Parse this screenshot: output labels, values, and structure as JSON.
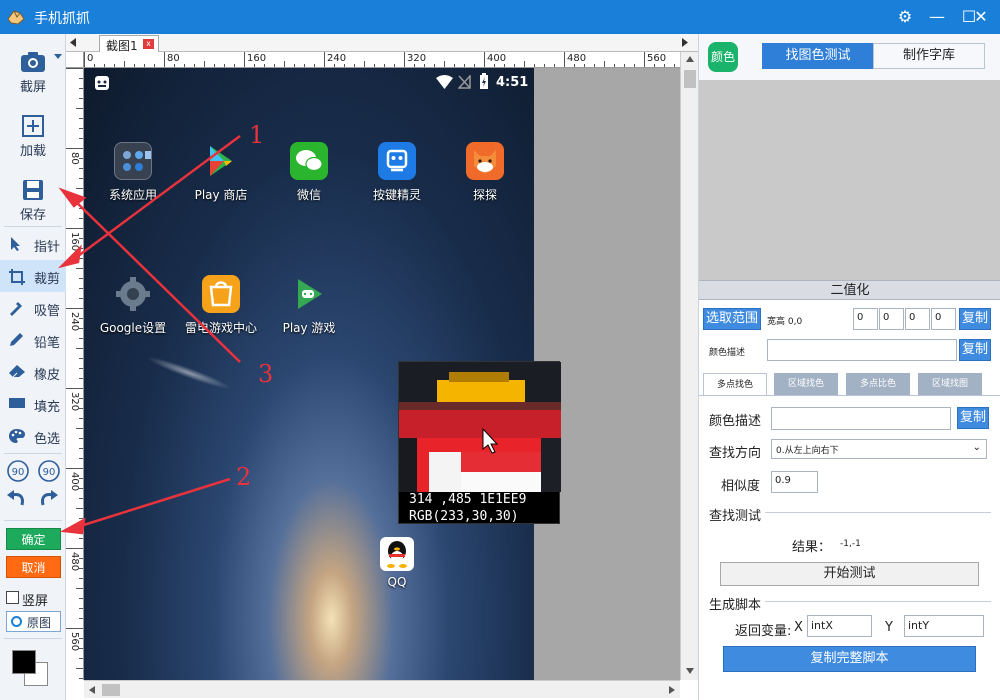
{
  "window": {
    "title": "手机抓抓",
    "buttons": {
      "settings": "⚙",
      "minimize": "—",
      "maximize": "☐",
      "close": "✕"
    }
  },
  "toolbar": {
    "screenshot": "截屏",
    "load": "加载",
    "save": "保存",
    "pointer": "指针",
    "crop": "裁剪",
    "picker": "吸管",
    "pencil": "铅笔",
    "eraser": "橡皮",
    "fill": "填充",
    "select_color": "色选",
    "rotate_left_label": "90",
    "rotate_right_label": "90",
    "confirm": "确定",
    "cancel": "取消",
    "portrait": "竖屏",
    "original": "原图"
  },
  "document_tab": {
    "label": "截图1",
    "close": "x"
  },
  "ruler": {
    "h_ticks": [
      "0",
      "80",
      "160",
      "240",
      "320",
      "400",
      "480",
      "560"
    ],
    "v_ticks": [
      "80",
      "160",
      "240",
      "320",
      "400",
      "480",
      "560"
    ]
  },
  "phone": {
    "status_time": "4:51",
    "apps": [
      {
        "label": "系统应用",
        "icon": "folder-icon"
      },
      {
        "label": "Play 商店",
        "icon": "play-store-icon"
      },
      {
        "label": "微信",
        "icon": "wechat-icon"
      },
      {
        "label": "按键精灵",
        "icon": "robot-icon"
      },
      {
        "label": "探探",
        "icon": "fox-icon"
      },
      {
        "label": "Google设置",
        "icon": "google-gear-icon"
      },
      {
        "label": "雷电游戏中心",
        "icon": "game-center-icon"
      },
      {
        "label": "Play 游戏",
        "icon": "play-games-icon"
      },
      {
        "label": "QQ",
        "icon": "qq-icon"
      }
    ]
  },
  "magnifier": {
    "coords_hex": "314 ,485  1E1EE9",
    "rgb": "RGB(233,30,30)"
  },
  "annotations": {
    "n1": "1",
    "n2": "2",
    "n3": "3"
  },
  "panel": {
    "color_badge": "颜色",
    "tab_find": "找图色测试",
    "tab_lib": "制作字库",
    "binarize": "二值化",
    "select_range": "选取范围",
    "size_label": "宽高 0,0",
    "range_values": [
      "0",
      "0",
      "0",
      "0"
    ],
    "copy": "复制",
    "color_desc_small": "颜色描述",
    "subtabs": [
      "多点找色",
      "区域找色",
      "多点比色",
      "区域找图"
    ],
    "color_desc": "颜色描述",
    "find_dir": "查找方向",
    "find_dir_value": "0.从左上向右下",
    "similarity": "相似度",
    "similarity_value": "0.9",
    "find_test": "查找测试",
    "result_label": "结果：",
    "result_value": "-1,-1",
    "start_test": "开始测试",
    "gen_script": "生成脚本",
    "return_var": "返回变量:",
    "x_label": "X",
    "x_value": "intX",
    "y_label": "Y",
    "y_value": "intY",
    "copy_script": "复制完整脚本"
  }
}
